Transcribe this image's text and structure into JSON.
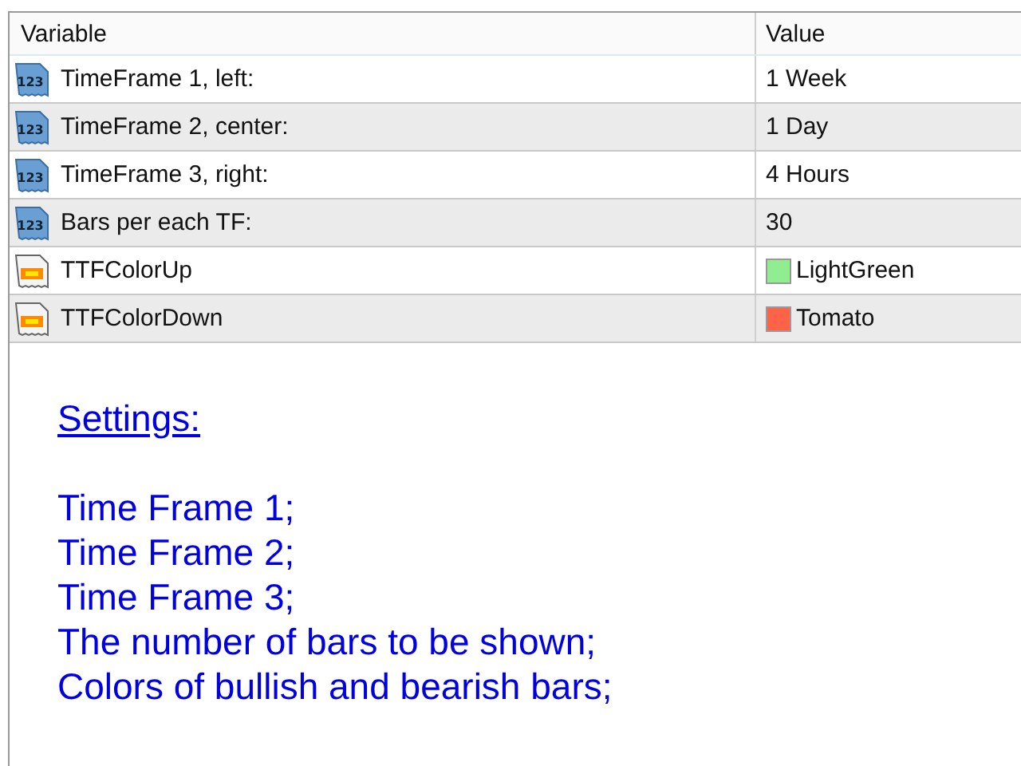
{
  "table": {
    "columns": [
      "Variable",
      "Value"
    ],
    "rows": [
      {
        "kind": "number",
        "icon_text": "123",
        "variable": "TimeFrame 1, left:",
        "value": "1 Week"
      },
      {
        "kind": "number",
        "icon_text": "123",
        "variable": "TimeFrame 2, center:",
        "value": "1 Day"
      },
      {
        "kind": "number",
        "icon_text": "123",
        "variable": "TimeFrame 3, right:",
        "value": "4 Hours"
      },
      {
        "kind": "number",
        "icon_text": "123",
        "variable": "Bars per each TF:",
        "value": "30"
      },
      {
        "kind": "color",
        "variable": "TTFColorUp",
        "value": "LightGreen",
        "color": "#90ee90"
      },
      {
        "kind": "color",
        "variable": "TTFColorDown",
        "value": "Tomato",
        "color": "#ff6347"
      }
    ]
  },
  "description": {
    "heading": "Settings:",
    "lines": [
      "Time Frame 1;",
      "Time Frame 2;",
      "Time Frame 3;",
      "The number of bars to be shown;",
      "Colors of bullish and bearish bars;"
    ]
  }
}
